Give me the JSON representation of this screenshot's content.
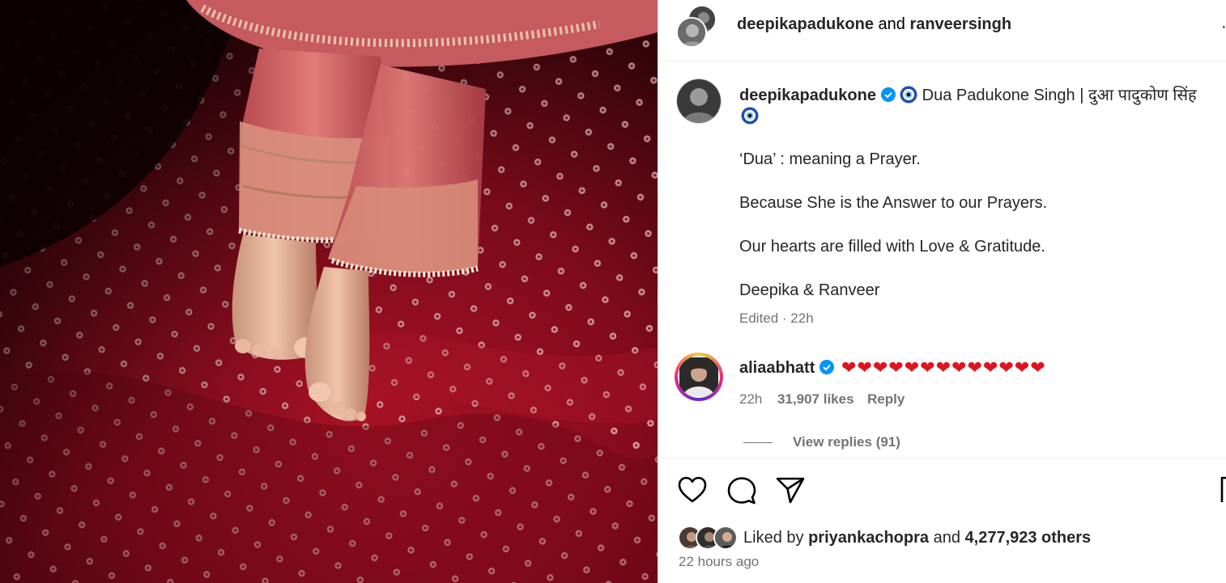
{
  "post": {
    "header": {
      "user1": "deepikapadukone",
      "and_word": "and",
      "user2": "ranveersingh"
    },
    "caption": {
      "username": "deepikapadukone",
      "title": "Dua Padukone Singh | दुआ पादुकोण सिंह",
      "lines": [
        "‘Dua’ : meaning a Prayer.",
        "Because She is the Answer to our Prayers.",
        "Our hearts are filled with Love & Gratitude.",
        "Deepika & Ranveer"
      ],
      "meta": "Edited · 22h"
    },
    "comment": {
      "username": "aliaabhatt",
      "text": "❤❤❤❤❤❤❤❤❤❤❤❤❤",
      "time": "22h",
      "likes": "31,907 likes",
      "reply_label": "Reply",
      "view_replies": "View replies (91)"
    },
    "liked": {
      "prefix": "Liked by",
      "user": "priyankachopra",
      "middle": "and",
      "others": "4,277,923 others"
    },
    "time_ago": "22 hours ago"
  },
  "colors": {
    "verified": "#0095f6",
    "heart": "#e0141e",
    "muted": "#737373",
    "story_ring": "#ee2a7b"
  },
  "icons": [
    "verified-badge-icon",
    "evil-eye-icon",
    "like-icon",
    "comment-icon",
    "share-icon",
    "save-icon",
    "more-options-icon"
  ]
}
